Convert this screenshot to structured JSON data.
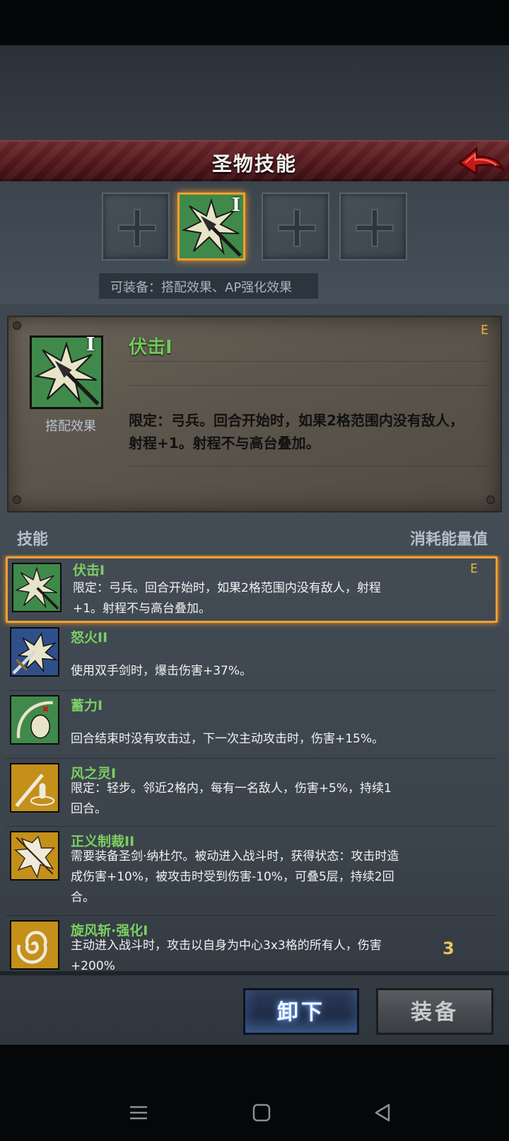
{
  "header": {
    "title": "圣物技能"
  },
  "slots": [
    {
      "state": "empty",
      "icon": "cross-icon"
    },
    {
      "state": "equipped",
      "icon": "spear-burst-icon",
      "roman": "I"
    },
    {
      "state": "empty",
      "icon": "cross-icon"
    },
    {
      "state": "empty",
      "icon": "cross-icon"
    }
  ],
  "equip_hint": "可装备：搭配效果、AP强化效果",
  "detail": {
    "name": "伏击I",
    "roman": "I",
    "sub_label": "搭配效果",
    "badge": "E",
    "description": "限定：弓兵。回合开始时，如果2格范围内没有敌人，射程+1。射程不与高台叠加。"
  },
  "list_header": {
    "left": "技能",
    "right": "消耗能量值"
  },
  "skills": [
    {
      "name": "伏击I",
      "desc": "限定：弓兵。回合开始时，如果2格范围内没有敌人，射程+1。射程不与高台叠加。",
      "tag": "E",
      "cost": "",
      "icon": "spear-burst-icon"
    },
    {
      "name": "怒火II",
      "desc": "使用双手剑时，爆击伤害+37%。",
      "tag": "",
      "cost": "",
      "icon": "sword-burst-icon"
    },
    {
      "name": "蓄力I",
      "desc": "回合结束时没有攻击过，下一次主动攻击时，伤害+15%。",
      "tag": "",
      "cost": "",
      "icon": "archer-charge-icon"
    },
    {
      "name": "风之灵I",
      "desc": "限定：轻步。邻近2格内，每有一名敌人，伤害+5%，持续1回合。",
      "tag": "",
      "cost": "",
      "icon": "wind-spirit-icon"
    },
    {
      "name": "正义制裁II",
      "desc": "需要装备圣剑·纳杜尔。被动进入战斗时，获得状态：攻击时造成伤害+10%，被攻击时受到伤害-10%，可叠5层，持续2回合。",
      "tag": "",
      "cost": "",
      "icon": "holy-blade-icon"
    },
    {
      "name": "旋风斩·强化I",
      "desc": "主动进入战斗时，攻击以自身为中心3x3格的所有人，伤害+200%",
      "tag": "",
      "cost": "3",
      "icon": "whirlwind-icon"
    }
  ],
  "buttons": {
    "unequip": "卸下",
    "equip": "装备"
  },
  "colors": {
    "accent_orange": "#f0a030",
    "skill_name_green": "#7ccf62",
    "banner_red": "#55191e"
  }
}
